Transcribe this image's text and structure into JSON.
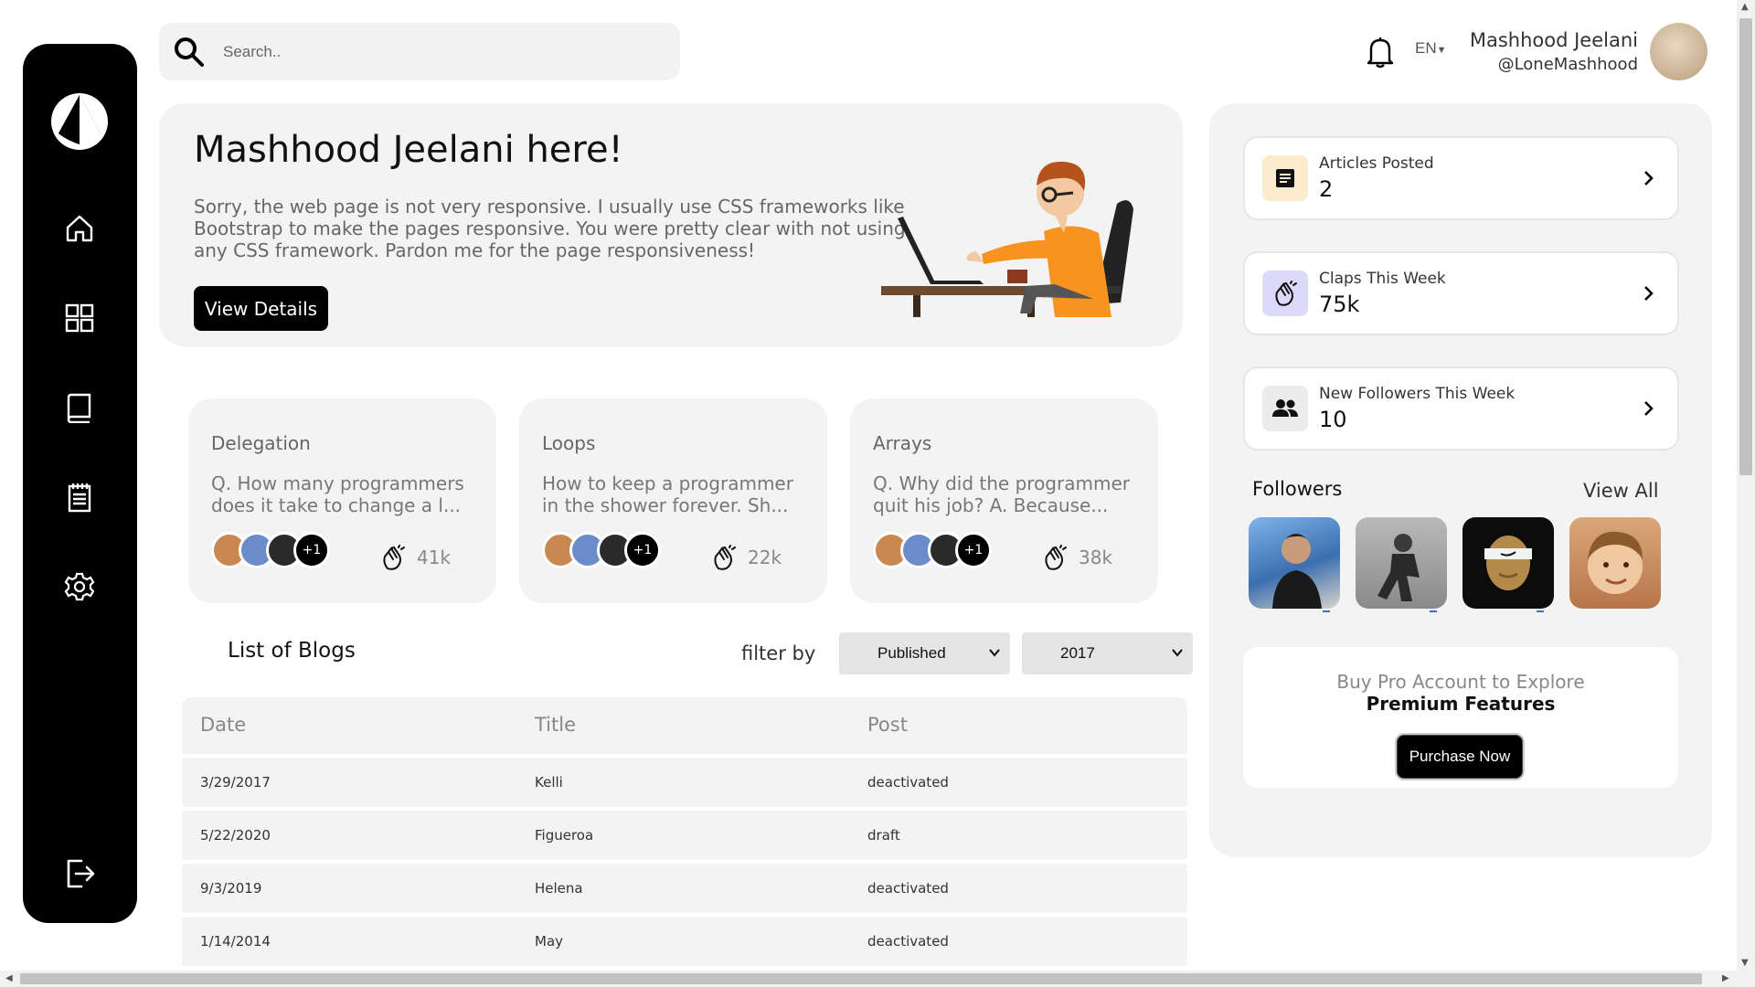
{
  "search": {
    "placeholder": "Search.."
  },
  "header": {
    "language": "EN",
    "user_name": "Mashhood Jeelani",
    "user_handle": "@LoneMashhood"
  },
  "hero": {
    "title": "Mashhood Jeelani here!",
    "text": "Sorry, the web page is not very responsive. I usually use CSS frameworks like Bootstrap to make the pages responsive. You were pretty clear with not using any CSS framework. Pardon me for the page responsiveness!",
    "button": "View Details"
  },
  "cards": [
    {
      "title": "Delegation",
      "body": "Q. How many programmers does it take to change a l...",
      "more": "+1",
      "claps": "41k"
    },
    {
      "title": "Loops",
      "body": "How to keep a programmer in the shower forever. Sh...",
      "more": "+1",
      "claps": "22k"
    },
    {
      "title": "Arrays",
      "body": "Q. Why did the programmer quit his job? A. Because...",
      "more": "+1",
      "claps": "38k"
    }
  ],
  "blogs": {
    "title": "List of Blogs",
    "filter_label": "filter by",
    "status_filter": "Published",
    "year_filter": "2017",
    "columns": [
      "Date",
      "Title",
      "Post"
    ],
    "rows": [
      {
        "date": "3/29/2017",
        "title": "Kelli",
        "post": "deactivated"
      },
      {
        "date": "5/22/2020",
        "title": "Figueroa",
        "post": "draft"
      },
      {
        "date": "9/3/2019",
        "title": "Helena",
        "post": "deactivated"
      },
      {
        "date": "1/14/2014",
        "title": "May",
        "post": "deactivated"
      }
    ]
  },
  "stats": [
    {
      "label": "Articles Posted",
      "value": "2",
      "icon": "article-icon",
      "color": "#fbeccd"
    },
    {
      "label": "Claps This Week",
      "value": "75k",
      "icon": "clap-icon",
      "color": "#ddd9fb"
    },
    {
      "label": "New Followers This Week",
      "value": "10",
      "icon": "people-icon",
      "color": "#ececec"
    }
  ],
  "followers": {
    "title": "Followers",
    "view_all": "View All"
  },
  "pro": {
    "line1": "Buy Pro Account to Explore",
    "line2": "Premium Features",
    "button": "Purchase Now"
  },
  "colors": {
    "sidebar": "#000000",
    "panel": "#f3f3f3",
    "accent": "#000000"
  }
}
